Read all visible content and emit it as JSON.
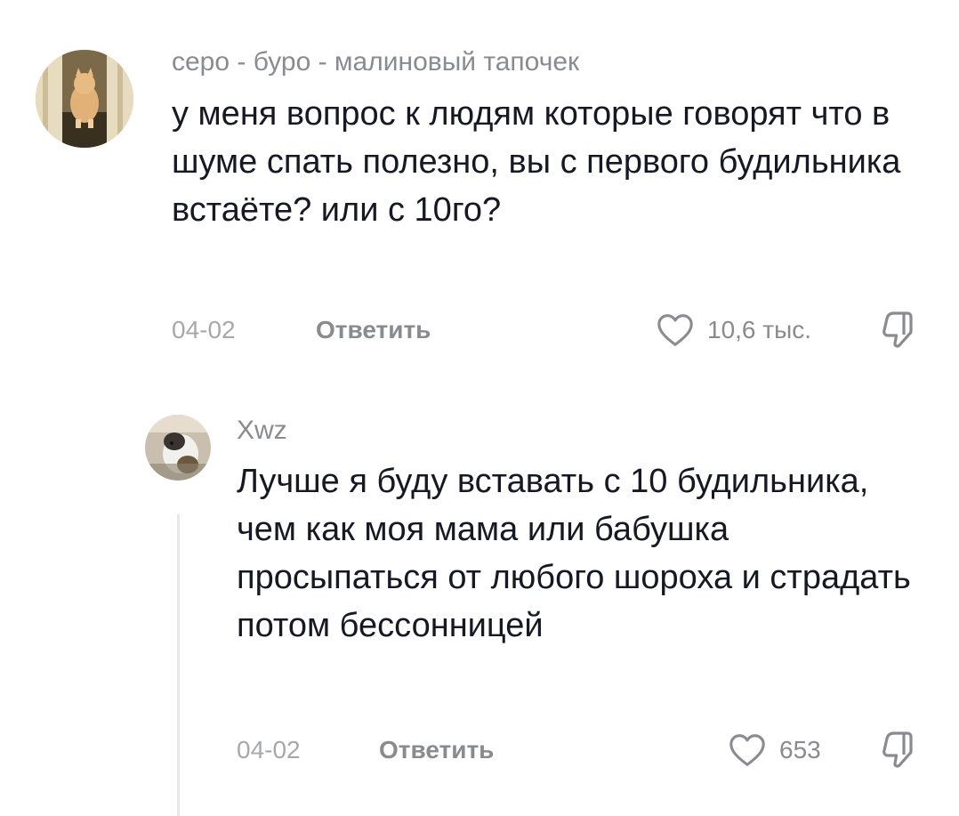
{
  "comments": [
    {
      "username": "серо - буро - малиновый тапочек",
      "text": "у меня вопрос к людям которые говорят что в шуме спать полезно, вы с первого будильника встаёте? или с 10го?",
      "date": "04-02",
      "reply_label": "Ответить",
      "likes": "10,6 тыс."
    },
    {
      "username": "Xwz",
      "text": "Лучше я буду вставать с 10 будильника, чем как моя мама или бабушка просыпаться от любого шороха и страдать потом бессонницей",
      "date": "04-02",
      "reply_label": "Ответить",
      "likes": "653"
    }
  ],
  "icons": {
    "like": "heart-outline-icon",
    "dislike": "thumbs-down-icon"
  },
  "colors": {
    "text": "#161823",
    "secondary": "#8a8b91",
    "date": "#a7a8ac",
    "thread_line": "#e8e8ea"
  }
}
